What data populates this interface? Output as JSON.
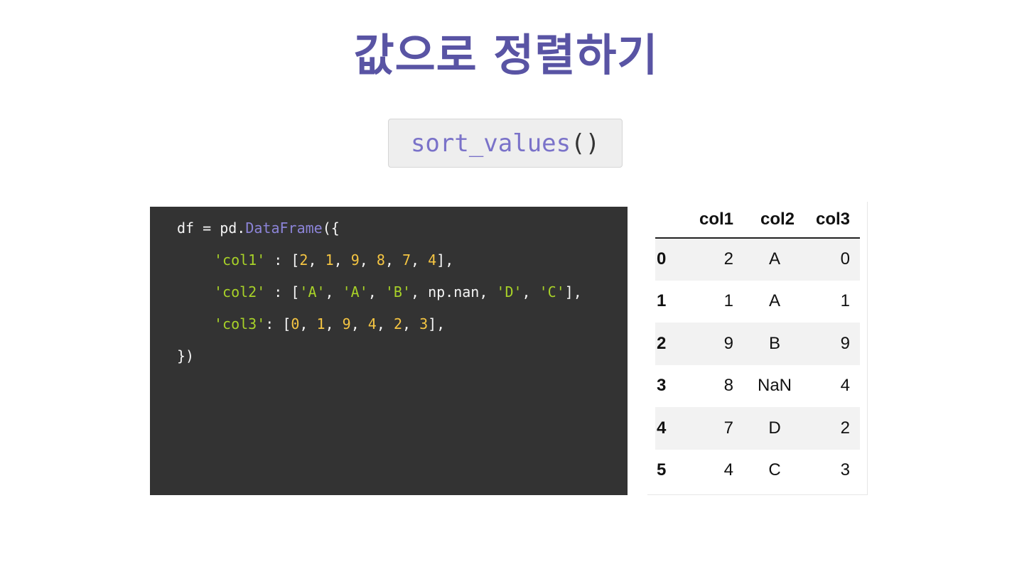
{
  "title": "값으로 정렬하기",
  "method": {
    "name": "sort_values",
    "parens": "()"
  },
  "code": {
    "line1": {
      "a": "df = pd.",
      "b": "DataFrame",
      "c": "({"
    },
    "line2": {
      "key": "'col1'",
      "sep": " : [",
      "v": [
        "2",
        "1",
        "9",
        "8",
        "7",
        "4"
      ],
      "end": "],"
    },
    "line3": {
      "key": "'col2'",
      "sep": " : [",
      "v": [
        "'A'",
        "'A'",
        "'B'",
        "np.nan",
        "'D'",
        "'C'"
      ],
      "end": "],"
    },
    "line4": {
      "key": "'col3'",
      "sep": ": [",
      "v": [
        "0",
        "1",
        "9",
        "4",
        "2",
        "3"
      ],
      "end": "],"
    },
    "line5": "})",
    "comma": ", "
  },
  "table": {
    "columns": [
      "",
      "col1",
      "col2",
      "col3"
    ],
    "rows": [
      [
        "0",
        "2",
        "A",
        "0"
      ],
      [
        "1",
        "1",
        "A",
        "1"
      ],
      [
        "2",
        "9",
        "B",
        "9"
      ],
      [
        "3",
        "8",
        "NaN",
        "4"
      ],
      [
        "4",
        "7",
        "D",
        "2"
      ],
      [
        "5",
        "4",
        "C",
        "3"
      ]
    ]
  },
  "colors": {
    "title": "#5954a4",
    "method": "#7a72c9",
    "code_bg": "#333333",
    "code_string": "#a8d228",
    "code_number": "#f5c542",
    "code_function": "#8c84d8"
  }
}
